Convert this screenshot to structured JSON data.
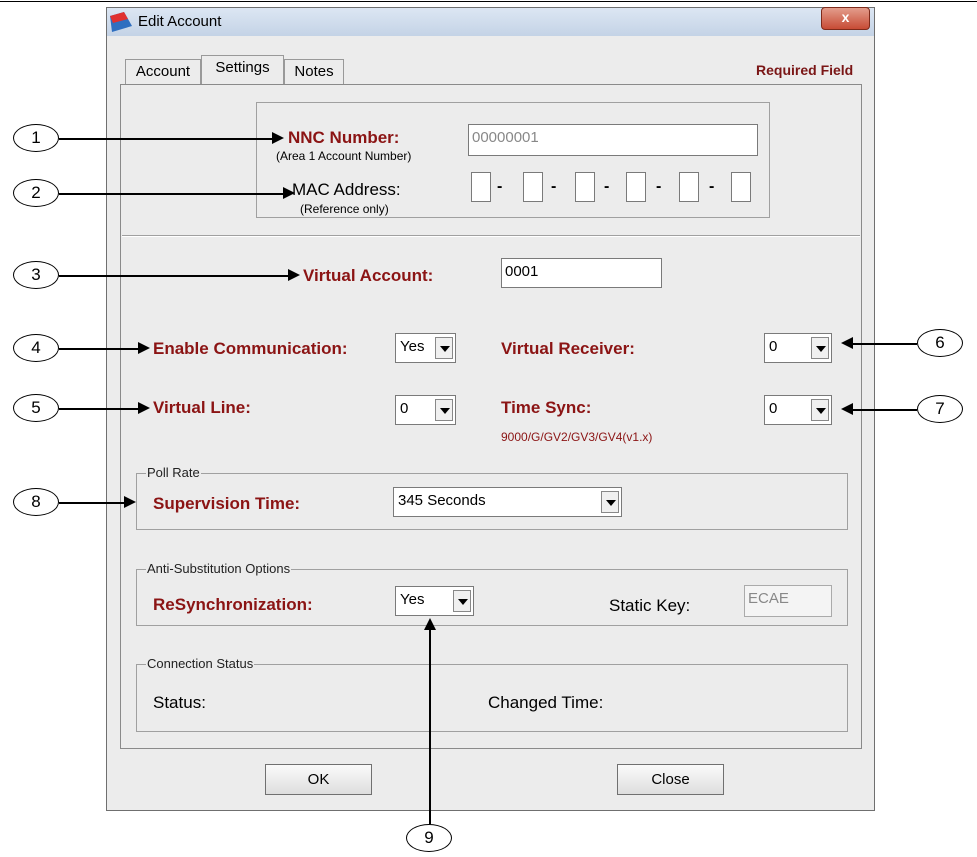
{
  "window": {
    "title": "Edit Account",
    "close_glyph": "x"
  },
  "tabs": [
    {
      "label": "Account"
    },
    {
      "label": "Settings"
    },
    {
      "label": "Notes"
    }
  ],
  "required_field": "Required Field",
  "nnc": {
    "label": "NNC Number:",
    "sub": "(Area 1 Account Number)",
    "value": "00000001"
  },
  "mac": {
    "label": "MAC Address:",
    "sub": "(Reference only)",
    "dash": "-"
  },
  "virtual_account": {
    "label": "Virtual Account:",
    "value": "0001"
  },
  "enable_comm": {
    "label": "Enable Communication:",
    "value": "Yes"
  },
  "virtual_receiver": {
    "label": "Virtual Receiver:",
    "value": "0"
  },
  "virtual_line": {
    "label": "Virtual Line:",
    "value": "0"
  },
  "time_sync": {
    "label": "Time Sync:",
    "value": "0",
    "note": "9000/G/GV2/GV3/GV4(v1.x)"
  },
  "poll_rate": {
    "title": "Poll Rate",
    "label": "Supervision Time:",
    "value": "345  Seconds"
  },
  "anti_sub": {
    "title": "Anti-Substitution Options",
    "resync_label": "ReSynchronization:",
    "resync_value": "Yes",
    "static_key_label": "Static Key:",
    "static_key_value": "ECAE"
  },
  "connection": {
    "title": "Connection Status",
    "status_label": "Status:",
    "changed_label": "Changed Time:"
  },
  "buttons": {
    "ok": "OK",
    "close": "Close"
  },
  "callouts": [
    "1",
    "2",
    "3",
    "4",
    "5",
    "6",
    "7",
    "8",
    "9"
  ],
  "colors": {
    "label_red": "#8b1414",
    "close_button": "#c74b35"
  }
}
